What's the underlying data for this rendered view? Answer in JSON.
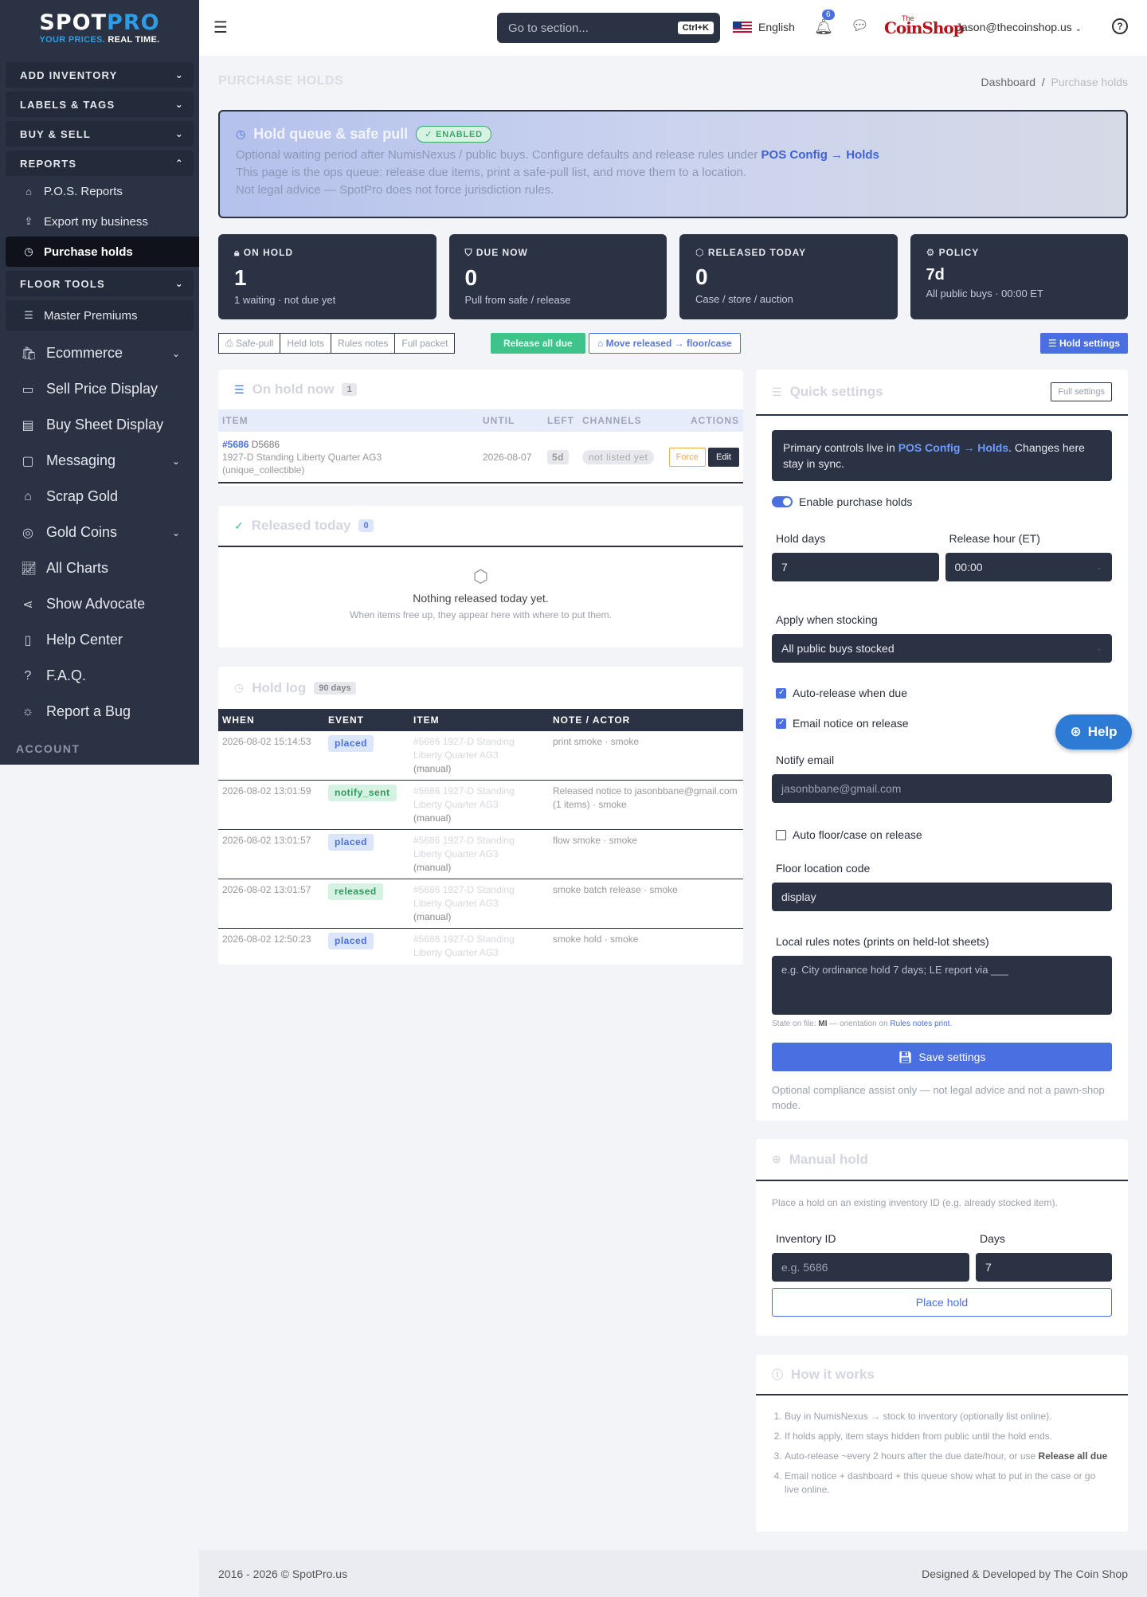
{
  "brand": {
    "name_a": "SPOT",
    "name_b": "PRO",
    "tag_a": "YOUR PRICES.",
    "tag_b": " REAL TIME."
  },
  "sidebar": {
    "sections": [
      {
        "label": "ADD INVENTORY"
      },
      {
        "label": "LABELS & TAGS"
      },
      {
        "label": "BUY & SELL"
      },
      {
        "label": "REPORTS"
      }
    ],
    "report_items": [
      {
        "label": "P.O.S. Reports",
        "icon": "pos-icon"
      },
      {
        "label": "Export my business",
        "icon": "export-icon"
      },
      {
        "label": "Purchase holds",
        "icon": "clock-icon"
      }
    ],
    "floor_tools": "FLOOR TOOLS",
    "master_premiums": "Master Premiums",
    "nav": [
      {
        "label": "Ecommerce",
        "icon": "bag-icon",
        "chevron": true
      },
      {
        "label": "Sell Price Display",
        "icon": "briefcase-icon",
        "chevron": false
      },
      {
        "label": "Buy Sheet Display",
        "icon": "book-icon",
        "chevron": false
      },
      {
        "label": "Messaging",
        "icon": "message-icon",
        "chevron": true
      },
      {
        "label": "Scrap Gold",
        "icon": "tag-icon",
        "chevron": false
      },
      {
        "label": "Gold Coins",
        "icon": "coins-icon",
        "chevron": true
      },
      {
        "label": "All Charts",
        "icon": "chart-icon",
        "chevron": false
      },
      {
        "label": "Show Advocate",
        "icon": "share-icon",
        "chevron": false
      },
      {
        "label": "Help Center",
        "icon": "book-open-icon",
        "chevron": false
      },
      {
        "label": "F.A.Q.",
        "icon": "question-icon",
        "chevron": false
      },
      {
        "label": "Report a Bug",
        "icon": "bug-icon",
        "chevron": false
      }
    ],
    "account": "ACCOUNT"
  },
  "topbar": {
    "search_placeholder": "Go to section...",
    "shortcut": "Ctrl+K",
    "language": "English",
    "notif_count": "6",
    "user": "Jason@thecoinshop.us",
    "shop_logo_the": "The",
    "shop_logo": "CoinShop"
  },
  "page": {
    "title": "PURCHASE HOLDS",
    "crumb_home": "Dashboard",
    "crumb_sep": "/",
    "crumb_current": "Purchase holds"
  },
  "banner": {
    "title": "Hold queue & safe pull",
    "status": "ENABLED",
    "line1": "Optional waiting period after NumisNexus / public buys. Configure defaults and release rules under",
    "link": "POS Config → Holds",
    "line2": "This page is the ops queue: release due items, print a safe-pull list, and move them to a location.",
    "line3": "Not legal advice — SpotPro does not force jurisdiction rules."
  },
  "stats": [
    {
      "label": "ON HOLD",
      "value": "1",
      "desc": "1 waiting · not due yet",
      "icon": "lock-icon"
    },
    {
      "label": "DUE NOW",
      "value": "0",
      "desc": "Pull from safe / release",
      "icon": "shield-icon"
    },
    {
      "label": "RELEASED TODAY",
      "value": "0",
      "desc": "Case / store / auction",
      "icon": "box-icon"
    },
    {
      "label": "POLICY",
      "value": "7d",
      "desc": "All public buys · 00:00 ET",
      "icon": "gear-icon"
    }
  ],
  "actions": {
    "group": [
      "Safe-pull",
      "Held lots",
      "Rules notes",
      "Full packet"
    ],
    "release_all": "Release all due",
    "move_released": "Move released → floor/case",
    "hold_settings": "Hold settings"
  },
  "onhold": {
    "title": "On hold now",
    "count": "1",
    "headers": [
      "ITEM",
      "UNTIL",
      "LEFT",
      "CHANNELS",
      "ACTIONS"
    ],
    "rows": [
      {
        "id": "#5686",
        "sku": "D5686",
        "name": "1927-D Standing Liberty Quarter AG3",
        "type": "(unique_collectible)",
        "until": "2026-08-07",
        "left": "5d",
        "channel": "not listed yet",
        "force": "Force",
        "edit": "Edit"
      }
    ]
  },
  "released": {
    "title": "Released today",
    "count": "0",
    "empty_title": "Nothing released today yet.",
    "empty_desc": "When items free up, they appear here with where to put them."
  },
  "holdlog": {
    "title": "Hold log",
    "count": "90 days",
    "headers": [
      "WHEN",
      "EVENT",
      "ITEM",
      "NOTE / ACTOR"
    ],
    "rows": [
      {
        "when": "2026-08-02 15:14:53",
        "event": "placed",
        "item": "#5686 1927-D Standing Liberty Quarter AG3",
        "manual": "(manual)",
        "note": "print smoke · smoke"
      },
      {
        "when": "2026-08-02 13:01:59",
        "event": "notify_sent",
        "item": "#5686 1927-D Standing Liberty Quarter AG3",
        "manual": "(manual)",
        "note": "Released notice to jasonbbane@gmail.com (1 items) · smoke"
      },
      {
        "when": "2026-08-02 13:01:57",
        "event": "placed",
        "item": "#5686 1927-D Standing Liberty Quarter AG3",
        "manual": "(manual)",
        "note": "flow smoke · smoke"
      },
      {
        "when": "2026-08-02 13:01:57",
        "event": "released",
        "item": "#5686 1927-D Standing Liberty Quarter AG3",
        "manual": "(manual)",
        "note": "smoke batch release · smoke"
      },
      {
        "when": "2026-08-02 12:50:23",
        "event": "placed",
        "item": "#5686 1927-D Standing Liberty Quarter AG3",
        "manual": "",
        "note": "smoke hold · smoke"
      }
    ]
  },
  "quick": {
    "title": "Quick settings",
    "full_settings": "Full settings",
    "note_pre": "Primary controls live in ",
    "note_link": "POS Config → Holds",
    "note_post": ". Changes here stay in sync.",
    "enable_label": "Enable purchase holds",
    "hold_days_label": "Hold days",
    "hold_days": "7",
    "release_hour_label": "Release hour (ET)",
    "release_hour": "00:00",
    "apply_label": "Apply when stocking",
    "apply_value": "All public buys stocked",
    "auto_release": "Auto-release when due",
    "email_notice": "Email notice on release",
    "notify_email_label": "Notify email",
    "notify_email": "jasonbbane@gmail.com",
    "auto_floor": "Auto floor/case on release",
    "floor_code_label": "Floor location code",
    "floor_code": "display",
    "rules_label": "Local rules notes (prints on held-lot sheets)",
    "rules_placeholder": "e.g. City ordinance hold 7 days; LE report via ___",
    "state_pre": "State on file: ",
    "state": "MI",
    "state_mid": " — orientation on ",
    "state_link": "Rules notes print",
    "state_post": ".",
    "save": "Save settings",
    "disclaimer": "Optional compliance assist only — not legal advice and not a pawn-shop mode."
  },
  "manual": {
    "title": "Manual hold",
    "desc": "Place a hold on an existing inventory ID (e.g. already stocked item).",
    "inv_label": "Inventory ID",
    "inv_placeholder": "e.g. 5686",
    "days_label": "Days",
    "days": "7",
    "button": "Place hold"
  },
  "how": {
    "title": "How it works",
    "steps": [
      "Buy in NumisNexus → stock to inventory (optionally list online).",
      "If holds apply, item stays hidden from public until the hold ends.",
      "Auto-release ~every 2 hours after the due date/hour, or use ",
      "Email notice + dashboard + this queue show what to put in the case or go live online."
    ],
    "step3_bold": "Release all due"
  },
  "help_fab": "Help",
  "footer": {
    "left": "2016 - 2026 © SpotPro.us",
    "right": "Designed & Developed by The Coin Shop"
  },
  "colors": {
    "sidebar": "#2b3244",
    "accent": "#4a6fe0",
    "success": "#3ec48a"
  }
}
